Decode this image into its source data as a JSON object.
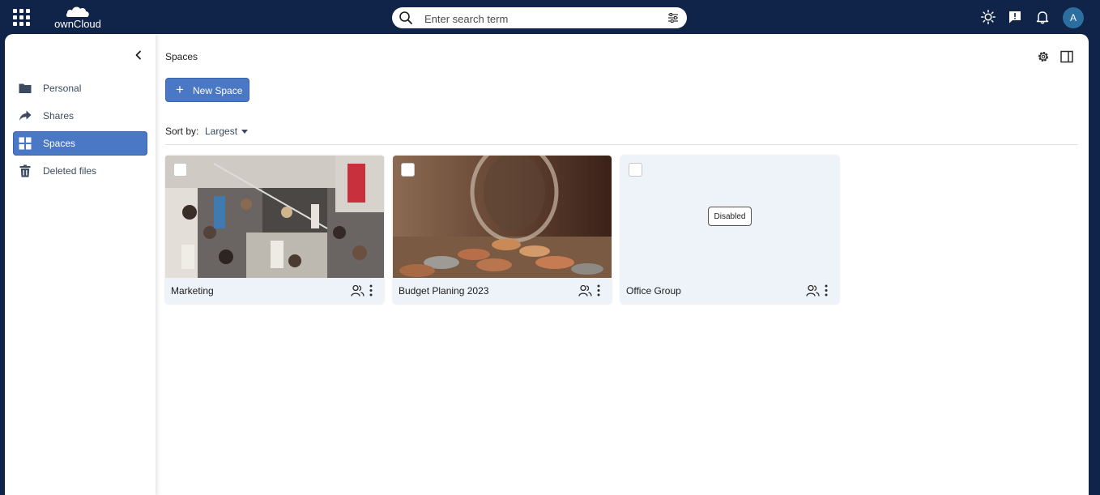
{
  "topbar": {
    "logo_text": "ownCloud",
    "search_placeholder": "Enter search term",
    "avatar_initial": "A"
  },
  "sidebar": {
    "items": [
      {
        "label": "Personal",
        "icon": "folder-icon",
        "active": false
      },
      {
        "label": "Shares",
        "icon": "share-arrow-icon",
        "active": false
      },
      {
        "label": "Spaces",
        "icon": "grid-icon",
        "active": true
      },
      {
        "label": "Deleted files",
        "icon": "trash-icon",
        "active": false
      }
    ]
  },
  "main": {
    "breadcrumb": "Spaces",
    "new_space_label": "New Space",
    "sort_label": "Sort by:",
    "sort_value": "Largest",
    "spaces": [
      {
        "name": "Marketing",
        "image": "trade-show-crowd-photo"
      },
      {
        "name": "Budget Planing 2023",
        "image": "coins-jar-photo"
      },
      {
        "name": "Office Group",
        "image": "none",
        "status": "Disabled"
      }
    ]
  },
  "colors": {
    "topbar_bg": "#0f2448",
    "accent": "#4a78c4",
    "card_bg": "#eef2f9"
  }
}
